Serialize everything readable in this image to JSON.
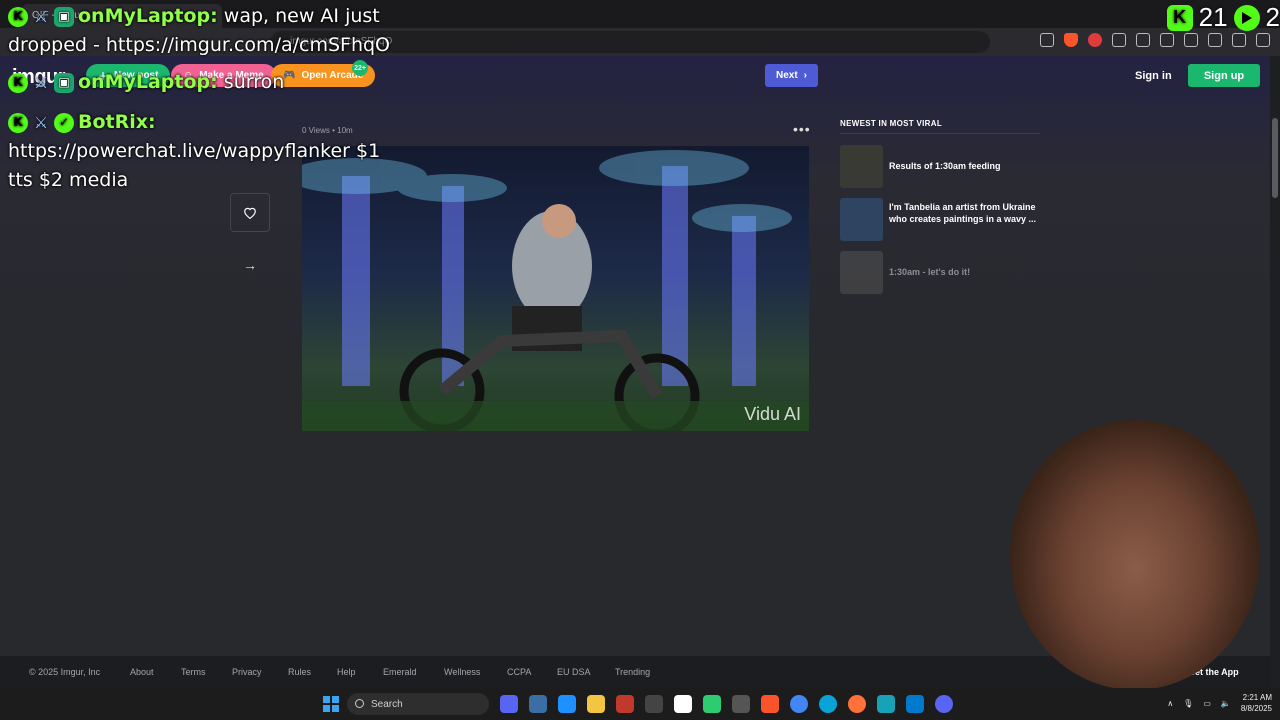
{
  "browser": {
    "tab_title": "GIF - Imgur",
    "url": "imgur.com/a/cmSFhqO"
  },
  "imgur": {
    "logo": "imgur",
    "new_post": "New post",
    "make_meme": "Make a Meme",
    "open_arcade": "Open Arcade",
    "arcade_badge": "22+",
    "next": "Next",
    "sign_in": "Sign in",
    "sign_up": "Sign up",
    "post_meta": "0 Views • 10m",
    "more": "•••",
    "watermark": "Vidu AI",
    "sidebar_title": "NEWEST IN MOST VIRAL",
    "sidebar_items": [
      {
        "title": "Results of 1:30am feeding"
      },
      {
        "title": "I'm Tanbelia an artist from Ukraine who creates paintings in a wavy ..."
      },
      {
        "title": "1:30am - let's do it!"
      }
    ],
    "footer": {
      "copyright": "© 2025 Imgur, Inc",
      "about": "About",
      "terms": "Terms",
      "privacy": "Privacy",
      "rules": "Rules",
      "help": "Help",
      "emerald": "Emerald",
      "wellness": "Wellness",
      "ccpa": "CCPA",
      "eudsa": "EU DSA",
      "trending": "Trending",
      "get_app": "Get the App"
    }
  },
  "chat": [
    {
      "user": "onMyLaptop:",
      "message": "wap, new AI just dropped - https://imgur.com/a/cmSFhqO"
    },
    {
      "user": "onMyLaptop:",
      "message": "surron"
    },
    {
      "user": "BotRix:",
      "message": "https://powerchat.live/wappyflanker $1 tts $2 media"
    }
  ],
  "stream": {
    "viewers": "21",
    "count2": "2"
  },
  "taskbar": {
    "search": "Search",
    "time": "2:21 AM",
    "date": "8/8/2025"
  },
  "colors": {
    "accent_green": "#1bb76e",
    "kick_green": "#53fc18",
    "next_blue": "#4f5bd5"
  }
}
